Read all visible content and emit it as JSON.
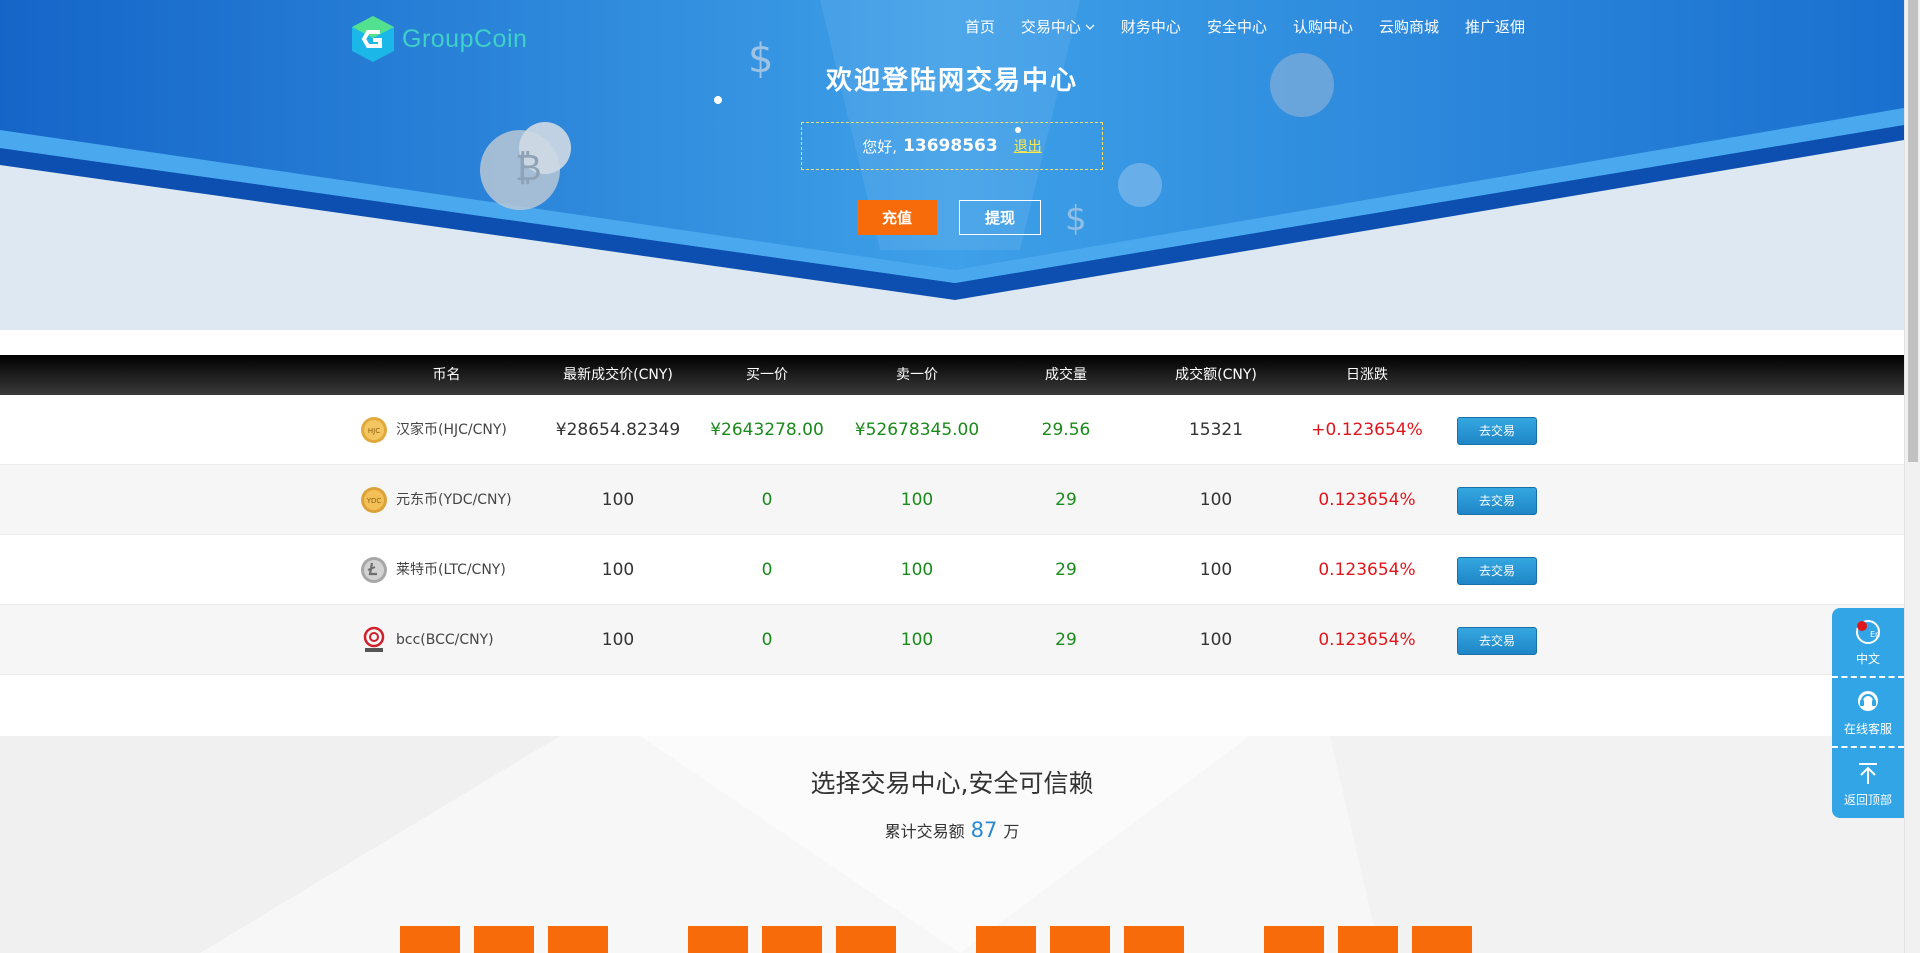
{
  "header": {
    "logo_text": "GroupCoin",
    "nav": [
      {
        "label": "首页"
      },
      {
        "label": "交易中心",
        "dropdown": true
      },
      {
        "label": "财务中心"
      },
      {
        "label": "安全中心"
      },
      {
        "label": "认购中心"
      },
      {
        "label": "云购商城"
      },
      {
        "label": "推广返佣"
      }
    ]
  },
  "hero": {
    "title": "欢迎登陆网交易中心",
    "greeting": "您好,",
    "username": "13698563",
    "logout": "退出",
    "charge_label": "充值",
    "withdraw_label": "提现"
  },
  "market": {
    "headers": {
      "name": "币名",
      "last": "最新成交价(CNY)",
      "buy": "买一价",
      "sell": "卖一价",
      "volume": "成交量",
      "amount": "成交额(CNY)",
      "change": "日涨跌"
    },
    "rows": [
      {
        "name": "汉家币(HJC/CNY)",
        "icon": "hjc-coin-icon",
        "last": "¥28654.82349",
        "buy": "¥2643278.00",
        "sell": "¥52678345.00",
        "volume": "29.56",
        "amount": "15321",
        "change": "+0.123654%",
        "action": "去交易"
      },
      {
        "name": "元东币(YDC/CNY)",
        "icon": "ydc-coin-icon",
        "last": "100",
        "buy": "0",
        "sell": "100",
        "volume": "29",
        "amount": "100",
        "change": "0.123654%",
        "action": "去交易"
      },
      {
        "name": "莱特币(LTC/CNY)",
        "icon": "ltc-coin-icon",
        "last": "100",
        "buy": "0",
        "sell": "100",
        "volume": "29",
        "amount": "100",
        "change": "0.123654%",
        "action": "去交易"
      },
      {
        "name": "bcc(BCC/CNY)",
        "icon": "bcc-coin-icon",
        "last": "100",
        "buy": "0",
        "sell": "100",
        "volume": "29",
        "amount": "100",
        "change": "0.123654%",
        "action": "去交易"
      }
    ]
  },
  "stats": {
    "title": "选择交易中心,安全可信赖",
    "sub_prefix": "累计交易额",
    "total": "87",
    "unit": "万"
  },
  "sidebar": {
    "items": [
      {
        "label": "中文",
        "icon": "language-icon"
      },
      {
        "label": "在线客服",
        "icon": "customer-service-icon"
      },
      {
        "label": "返回顶部",
        "icon": "back-to-top-icon"
      }
    ]
  },
  "colors": {
    "hero_blue": "#1b7fd6",
    "accent_orange": "#f76b0a",
    "up_green": "#1a8a1a",
    "change_red": "#e0161d",
    "side_blue": "#32a5e6"
  }
}
